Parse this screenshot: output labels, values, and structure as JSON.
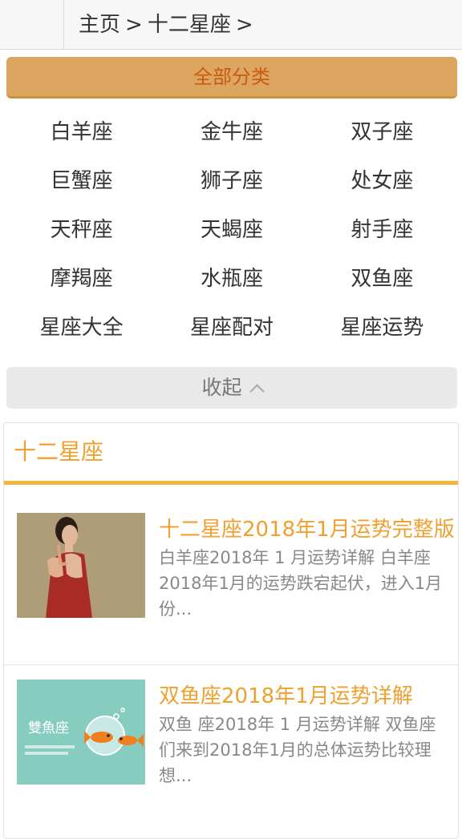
{
  "breadcrumb": {
    "home": "主页",
    "separator": ">",
    "current": "十二星座",
    "trailing": ">"
  },
  "category_header": "全部分类",
  "categories": [
    "白羊座",
    "金牛座",
    "双子座",
    "巨蟹座",
    "狮子座",
    "处女座",
    "天秤座",
    "天蝎座",
    "射手座",
    "摩羯座",
    "水瓶座",
    "双鱼座",
    "星座大全",
    "星座配对",
    "星座运势"
  ],
  "collapse_label": "收起",
  "section": {
    "title": "十二星座",
    "articles": [
      {
        "title": "十二星座2018年1月运势完整版",
        "desc": "白羊座2018年 1 月运势详解 白羊座2018年1月的运势跌宕起伏，进入1月份..."
      },
      {
        "title": "双鱼座2018年1月运势详解",
        "desc": "双鱼 座2018年 1 月运势详解 双鱼座们来到2018年1月的总体运势比较理想...",
        "thumb_text": "雙魚座"
      }
    ]
  },
  "colors": {
    "accent": "#f0a030",
    "header_bg": "#dca661",
    "header_text": "#c85b14"
  }
}
